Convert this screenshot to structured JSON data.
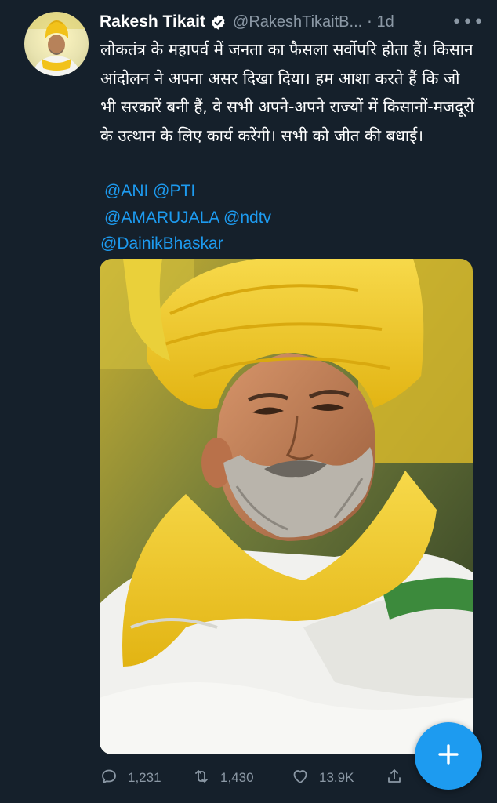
{
  "tweet": {
    "author_name": "Rakesh Tikait",
    "handle": "@RakeshTikaitB...",
    "separator": "·",
    "time": "1d",
    "more_label": "•••",
    "text": "लोकतंत्र के महापर्व में जनता का फैसला सर्वोपरि होता हैं। किसान आंदोलन ने अपना असर दिखा दिया। हम आशा करते हैं कि जो भी सरकारें बनी हैं, वे सभी अपने-अपने राज्यों में किसानों-मजदूरों के उत्थान के लिए कार्य करेंगी। सभी को जीत की बधाई।",
    "mentions": {
      "ani": "@ANI",
      "pti": "@PTI",
      "amarujala": "@AMARUJALA",
      "ndtv": "@ndtv",
      "dainikbhaskar": "@DainikBhaskar"
    }
  },
  "actions": {
    "replies": "1,231",
    "retweets": "1,430",
    "likes": "13.9K"
  },
  "icons": {
    "verified": "verified-badge-icon",
    "more": "more-options-icon",
    "reply": "reply-icon",
    "retweet": "retweet-icon",
    "like": "heart-icon",
    "share": "share-icon",
    "compose": "plus-icon"
  },
  "colors": {
    "background": "#15202b",
    "accent": "#1d9bf0",
    "secondary_text": "#8b98a5",
    "turban_yellow": "#f2c21a"
  }
}
